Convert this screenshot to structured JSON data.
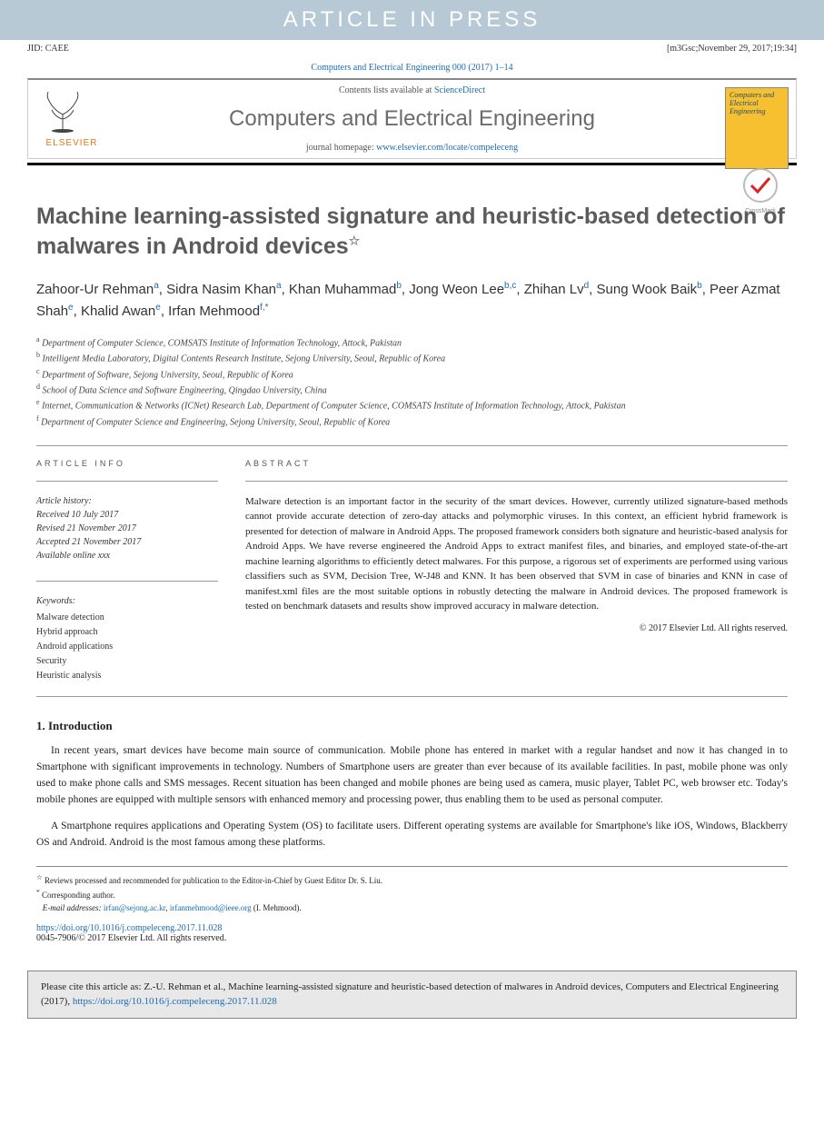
{
  "inpress": "ARTICLE IN PRESS",
  "topbar": {
    "jid": "JID: CAEE",
    "meta": "[m3Gsc;November 29, 2017;19:34]"
  },
  "journal_link_line": {
    "prefix": "",
    "journal": "Computers and Electrical Engineering 000 (2017) 1–14"
  },
  "header": {
    "contents_prefix": "Contents lists available at ",
    "contents_link": "ScienceDirect",
    "journal_name": "Computers and Electrical Engineering",
    "homepage_prefix": "journal homepage: ",
    "homepage_link": "www.elsevier.com/locate/compeleceng",
    "elsevier": "ELSEVIER",
    "cover_title": "Computers and Electrical Engineering"
  },
  "title": "Machine learning-assisted signature and heuristic-based detection of malwares in Android devices",
  "title_note_sym": "☆",
  "authors": [
    {
      "name": "Zahoor-Ur Rehman",
      "sup": "a"
    },
    {
      "name": "Sidra Nasim Khan",
      "sup": "a"
    },
    {
      "name": "Khan Muhammad",
      "sup": "b"
    },
    {
      "name": "Jong Weon Lee",
      "sup": "b,c"
    },
    {
      "name": "Zhihan Lv",
      "sup": "d"
    },
    {
      "name": "Sung Wook Baik",
      "sup": "b"
    },
    {
      "name": "Peer Azmat Shah",
      "sup": "e"
    },
    {
      "name": "Khalid Awan",
      "sup": "e"
    },
    {
      "name": "Irfan Mehmood",
      "sup": "f,*"
    }
  ],
  "affiliations": [
    {
      "sup": "a",
      "text": "Department of Computer Science, COMSATS Institute of Information Technology, Attock, Pakistan"
    },
    {
      "sup": "b",
      "text": "Intelligent Media Laboratory, Digital Contents Research Institute, Sejong University, Seoul, Republic of Korea"
    },
    {
      "sup": "c",
      "text": "Department of Software, Sejong University, Seoul, Republic of Korea"
    },
    {
      "sup": "d",
      "text": "School of Data Science and Software Engineering, Qingdao University, China"
    },
    {
      "sup": "e",
      "text": "Internet, Communication & Networks (ICNet) Research Lab, Department of Computer Science, COMSATS Institute of Information Technology, Attock, Pakistan"
    },
    {
      "sup": "f",
      "text": "Department of Computer Science and Engineering, Sejong University, Seoul, Republic of Korea"
    }
  ],
  "info_head": "ARTICLE INFO",
  "abstract_head": "ABSTRACT",
  "history_head": "Article history:",
  "history": [
    "Received 10 July 2017",
    "Revised 21 November 2017",
    "Accepted 21 November 2017",
    "Available online xxx"
  ],
  "keywords_head": "Keywords:",
  "keywords": [
    "Malware detection",
    "Hybrid approach",
    "Android applications",
    "Security",
    "Heuristic analysis"
  ],
  "abstract": "Malware detection is an important factor in the security of the smart devices. However, currently utilized signature-based methods cannot provide accurate detection of zero-day attacks and polymorphic viruses. In this context, an efficient hybrid framework is presented for detection of malware in Android Apps. The proposed framework considers both signature and heuristic-based analysis for Android Apps. We have reverse engineered the Android Apps to extract manifest files, and binaries, and employed state-of-the-art machine learning algorithms to efficiently detect malwares. For this purpose, a rigorous set of experiments are performed using various classifiers such as SVM, Decision Tree, W-J48 and KNN. It has been observed that SVM in case of binaries and KNN in case of manifest.xml files are the most suitable options in robustly detecting the malware in Android devices. The proposed framework is tested on benchmark datasets and results show improved accuracy in malware detection.",
  "copyright": "© 2017 Elsevier Ltd. All rights reserved.",
  "sections": {
    "intro_title": "1. Introduction",
    "intro_p1": "In recent years, smart devices have become main source of communication. Mobile phone has entered in market with a regular handset and now it has changed in to Smartphone with significant improvements in technology. Numbers of Smartphone users are greater than ever because of its available facilities. In past, mobile phone was only used to make phone calls and SMS messages. Recent situation has been changed and mobile phones are being used as camera, music player, Tablet PC, web browser etc. Today's mobile phones are equipped with multiple sensors with enhanced memory and processing power, thus enabling them to be used as personal computer.",
    "intro_p2": "A Smartphone requires applications and Operating System (OS) to facilitate users. Different operating systems are available for Smartphone's like iOS, Windows, Blackberry OS and Android. Android is the most famous among these platforms."
  },
  "footnotes": {
    "star": "Reviews processed and recommended for publication to the Editor-in-Chief by Guest Editor Dr. S. Liu.",
    "corr": "Corresponding author.",
    "email_prefix": "E-mail addresses: ",
    "email1": "irfan@sejong.ac.kr",
    "email2": "irfanmehmood@ieee.org",
    "email_suffix": " (I. Mehmood)."
  },
  "doi": {
    "link": "https://doi.org/10.1016/j.compeleceng.2017.11.028",
    "issn": "0045-7906/© 2017 Elsevier Ltd. All rights reserved."
  },
  "cite_box": {
    "prefix": "Please cite this article as: Z.-U. Rehman et al., Machine learning-assisted signature and heuristic-based detection of malwares in Android devices, Computers and Electrical Engineering (2017), ",
    "link": "https://doi.org/10.1016/j.compeleceng.2017.11.028"
  }
}
